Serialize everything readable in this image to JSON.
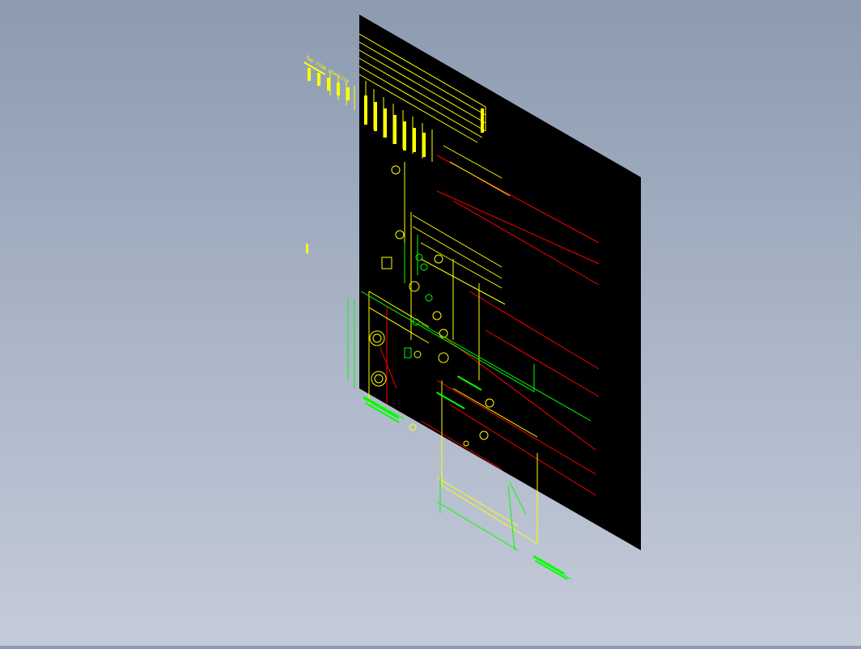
{
  "viewport": {
    "background_top": "#8c9bb0",
    "background_bottom": "#c4cbd9"
  },
  "drawing_sheet": {
    "fill": "#000000",
    "projection": "isometric"
  },
  "colors": {
    "yellow": "#ffff00",
    "red": "#ff0000",
    "green": "#00ff00",
    "white": "#ffffff"
  },
  "title_block": {
    "heading": "Two stop stencils"
  }
}
